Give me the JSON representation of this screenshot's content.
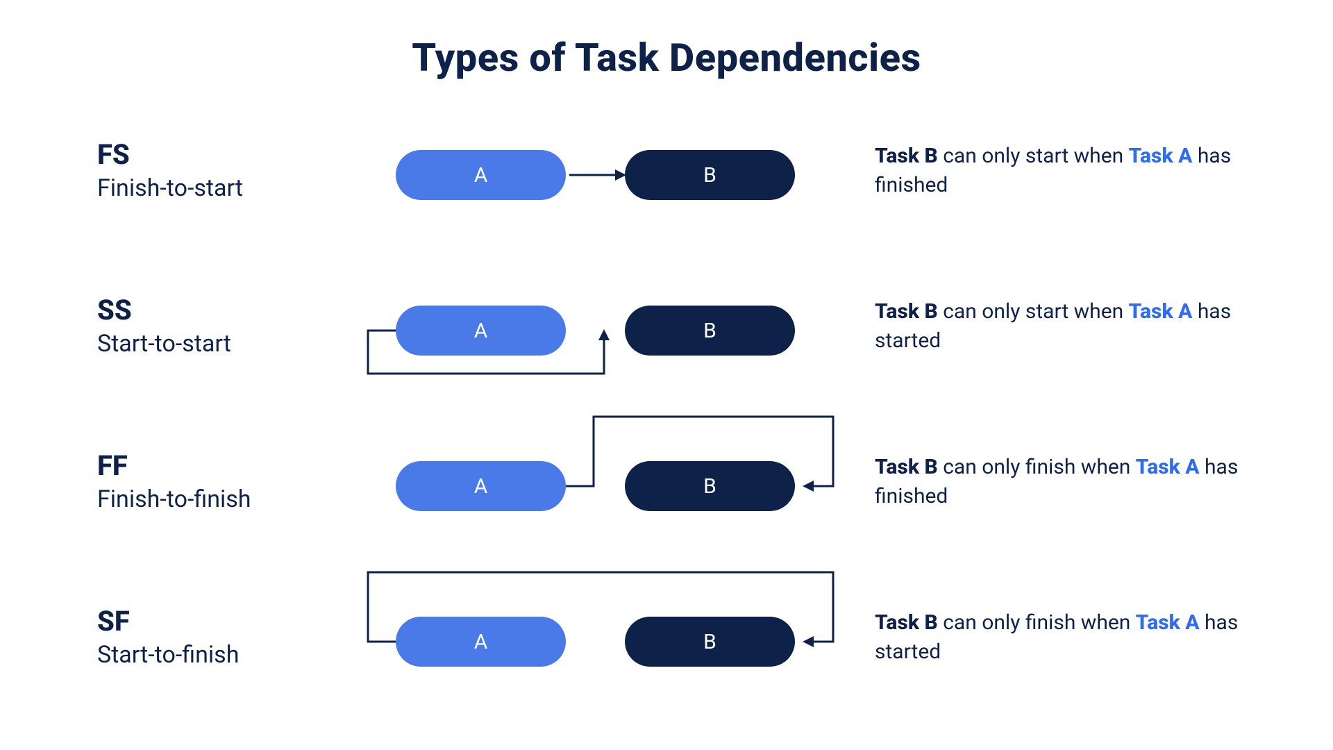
{
  "title": "Types of Task Dependencies",
  "task_labels": {
    "a": "A",
    "b": "B"
  },
  "rows": [
    {
      "code": "FS",
      "name": "Finish-to-start",
      "desc_b": "Task B",
      "desc_mid": " can only start when ",
      "desc_a": "Task A",
      "desc_end": " has finished"
    },
    {
      "code": "SS",
      "name": "Start-to-start",
      "desc_b": "Task B",
      "desc_mid": " can only start when ",
      "desc_a": "Task A",
      "desc_end": " has started"
    },
    {
      "code": "FF",
      "name": "Finish-to-finish",
      "desc_b": "Task B",
      "desc_mid": " can only finish when ",
      "desc_a": "Task A",
      "desc_end": " has finished"
    },
    {
      "code": "SF",
      "name": "Start-to-finish",
      "desc_b": "Task B",
      "desc_mid": " can only finish when ",
      "desc_a": "Task A",
      "desc_end": " has started"
    }
  ]
}
